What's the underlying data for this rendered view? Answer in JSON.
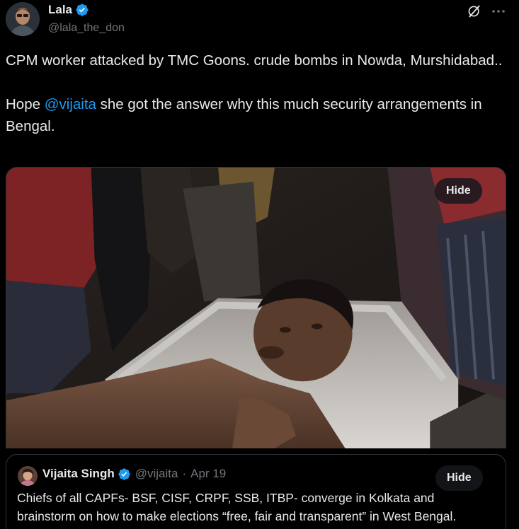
{
  "author": {
    "name": "Lala",
    "handle": "@lala_the_don"
  },
  "tweet": {
    "line1": "CPM worker attacked by TMC Goons. crude bombs in Nowda, Murshidabad..",
    "line2_prefix": "Hope ",
    "line2_mention": "@vijaita",
    "line2_suffix": " she got the answer why this much security arrangements in Bengal."
  },
  "media": {
    "hide_label": "Hide"
  },
  "quote": {
    "name": "Vijaita Singh",
    "handle": "@vijaita",
    "separator": "·",
    "date": "Apr 19",
    "hide_label": "Hide",
    "text": "Chiefs of all CAPFs- BSF, CISF, CRPF, SSB, ITBP- converge in Kolkata and brainstorm on how to make elections “free, fair and transparent” in West Bengal."
  },
  "icons": {
    "verified": "verified-badge-icon",
    "grok": "grok-icon",
    "more": "more-icon"
  },
  "colors": {
    "background": "#000000",
    "text": "#e7e9ea",
    "secondary": "#71767b",
    "accent": "#1d9bf0",
    "border": "#2f3336"
  }
}
